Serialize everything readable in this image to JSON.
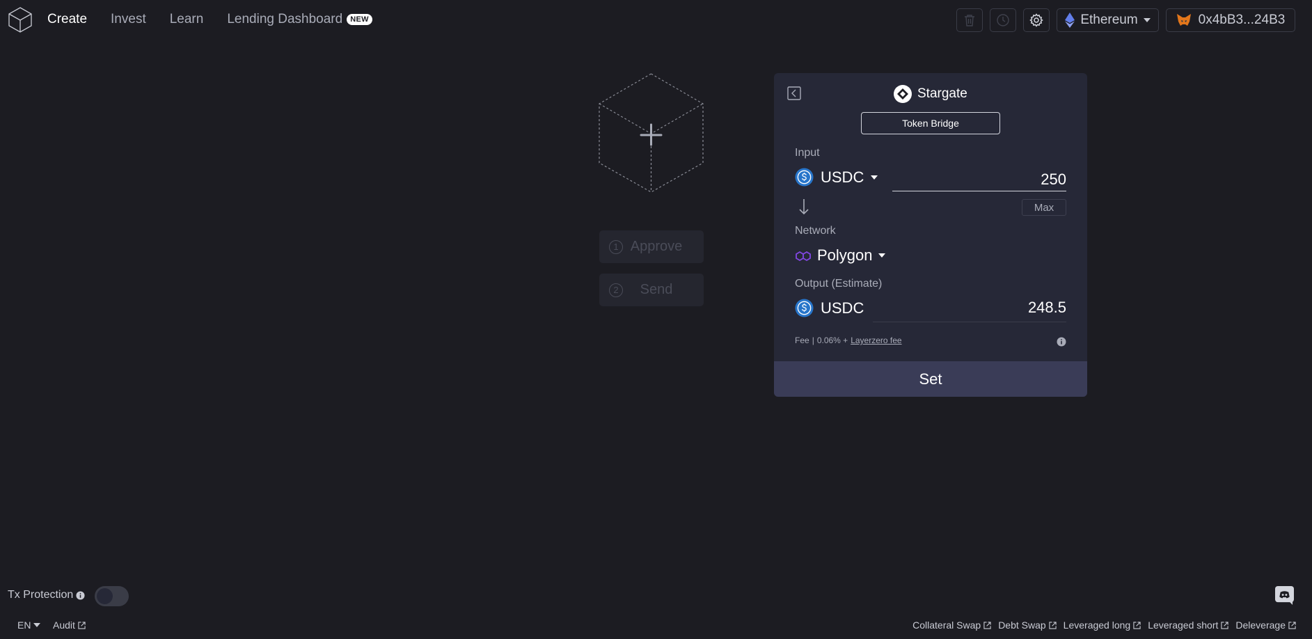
{
  "nav": {
    "items": [
      {
        "label": "Create",
        "active": true
      },
      {
        "label": "Invest",
        "active": false
      },
      {
        "label": "Learn",
        "active": false
      },
      {
        "label": "Lending Dashboard",
        "badge": "NEW",
        "active": false
      }
    ]
  },
  "toolbar": {
    "network_label": "Ethereum",
    "wallet_address": "0x4bB3...24B3",
    "icons": [
      "trash-icon",
      "history-icon",
      "gear-icon",
      "ethereum-icon",
      "metamask-icon"
    ]
  },
  "steps": [
    {
      "number": "1",
      "label": "Approve"
    },
    {
      "number": "2",
      "label": "Send"
    }
  ],
  "panel": {
    "title": "Stargate",
    "tab": "Token Bridge",
    "input_label": "Input",
    "input_token": "USDC",
    "input_amount": "250",
    "max_label": "Max",
    "network_label": "Network",
    "network_value": "Polygon",
    "output_label": "Output (Estimate)",
    "output_token": "USDC",
    "output_amount": "248.5",
    "fee_label": "Fee",
    "fee_separator": "|",
    "fee_value": "0.06% +",
    "fee_link": "Layerzero fee",
    "set_label": "Set"
  },
  "bottom": {
    "tx_protection_label": "Tx Protection",
    "tx_protection_enabled": false,
    "language": "EN",
    "audit_label": "Audit",
    "links": [
      "Collateral Swap",
      "Debt Swap",
      "Leveraged long",
      "Leveraged short",
      "Deleverage"
    ]
  },
  "colors": {
    "background": "#1c1c22",
    "panel": "#262837",
    "set_button": "#3a3c57",
    "usdc_blue": "#2775ca",
    "polygon_purple": "#8247e5",
    "ethereum_blue": "#627eea"
  }
}
